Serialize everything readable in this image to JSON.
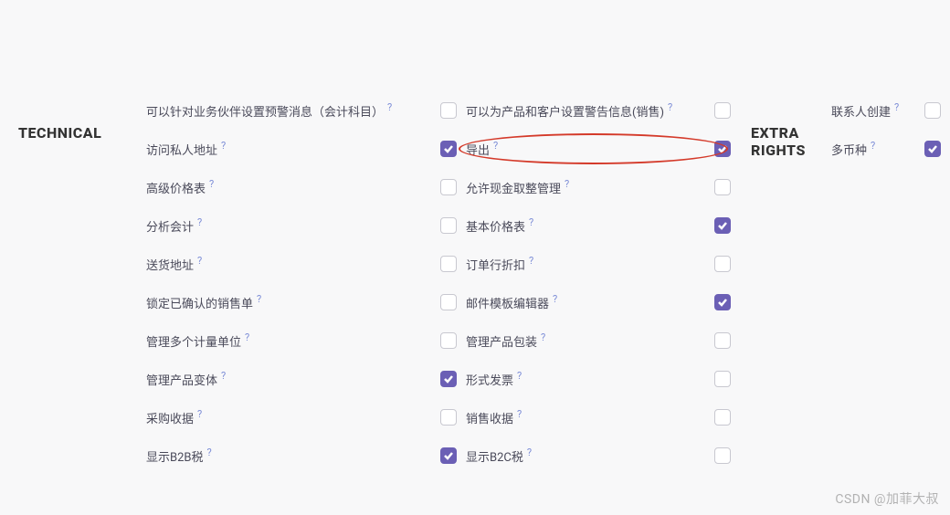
{
  "sections": {
    "technical": {
      "title": "TECHNICAL",
      "col1": [
        {
          "label": "可以针对业务伙伴设置预警消息（会计科目）",
          "checked": false
        },
        {
          "label": "访问私人地址",
          "checked": true
        },
        {
          "label": "高级价格表",
          "checked": false
        },
        {
          "label": "分析会计",
          "checked": false
        },
        {
          "label": "送货地址",
          "checked": false
        },
        {
          "label": "锁定已确认的销售单",
          "checked": false
        },
        {
          "label": "管理多个计量单位",
          "checked": false
        },
        {
          "label": "管理产品变体",
          "checked": true
        },
        {
          "label": "采购收据",
          "checked": false
        },
        {
          "label": "显示B2B税",
          "checked": true
        }
      ],
      "col2": [
        {
          "label": "可以为产品和客户设置警告信息(销售)",
          "checked": false
        },
        {
          "label": "导出",
          "checked": true,
          "highlight": true
        },
        {
          "label": "允许现金取整管理",
          "checked": false
        },
        {
          "label": "基本价格表",
          "checked": true
        },
        {
          "label": "订单行折扣",
          "checked": false
        },
        {
          "label": "邮件模板编辑器",
          "checked": true
        },
        {
          "label": "管理产品包装",
          "checked": false
        },
        {
          "label": "形式发票",
          "checked": false
        },
        {
          "label": "销售收据",
          "checked": false
        },
        {
          "label": "显示B2C税",
          "checked": false
        }
      ]
    },
    "extra": {
      "title": "EXTRA RIGHTS",
      "items": [
        {
          "label": "联系人创建",
          "checked": false
        },
        {
          "label": "多币种",
          "checked": true
        }
      ]
    }
  },
  "help_marker": "?",
  "watermark": "CSDN @加菲大叔"
}
